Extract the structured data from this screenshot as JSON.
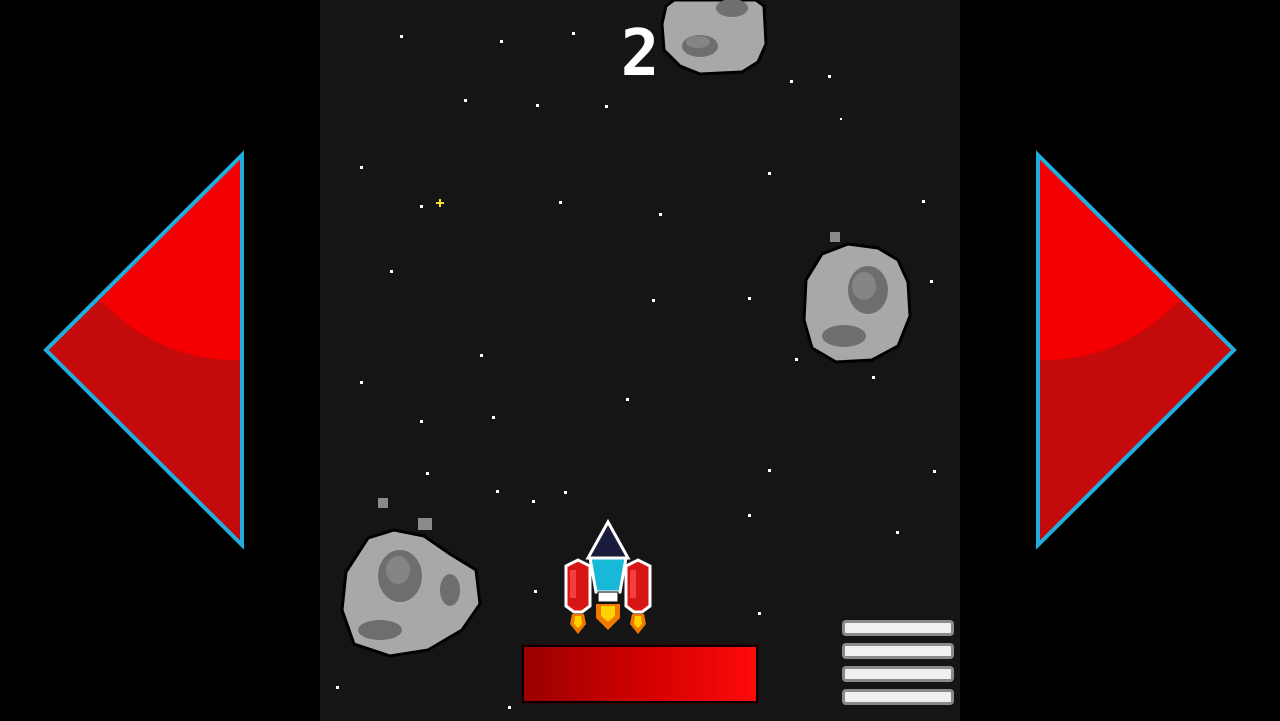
{
  "game": {
    "score": "2",
    "health_fraction": 1.0
  },
  "controls": {
    "left_icon": "left-arrow-triangle",
    "right_icon": "right-arrow-triangle",
    "menu_icon": "hamburger-menu"
  },
  "colors": {
    "background": "#000000",
    "playfield": "#151515",
    "arrow_fill": "#d40000",
    "arrow_highlight": "#f50000",
    "arrow_outline": "#1faee0",
    "health": "#e00000",
    "asteroid": "#a8a8a8",
    "ship_body": "#d81414",
    "ship_window": "#18b8d8"
  }
}
